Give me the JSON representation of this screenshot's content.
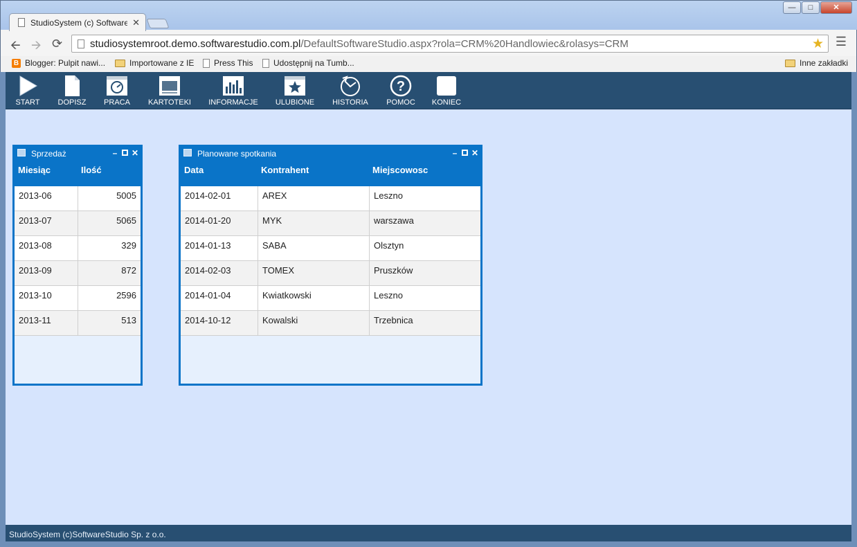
{
  "browser": {
    "tab_title": "StudioSystem (c) Software",
    "url_domain": "studiosystemroot.demo.softwarestudio.com.pl",
    "url_path": "/DefaultSoftwareStudio.aspx?rola=CRM%20Handlowiec&rolasys=CRM",
    "bookmarks": [
      {
        "label": "Blogger: Pulpit nawi...",
        "icon": "blogger-icon"
      },
      {
        "label": "Importowane z IE",
        "icon": "folder-icon"
      },
      {
        "label": "Press This",
        "icon": "page-icon"
      },
      {
        "label": "Udostępnij na Tumb...",
        "icon": "page-icon"
      }
    ],
    "other_bookmarks": "Inne zakładki"
  },
  "menu": [
    {
      "label": "START",
      "icon": "play-icon"
    },
    {
      "label": "DOPISZ",
      "icon": "new-document-icon"
    },
    {
      "label": "PRACA",
      "icon": "work-dashboard-icon"
    },
    {
      "label": "KARTOTEKI",
      "icon": "monitor-icon"
    },
    {
      "label": "INFORMACJE",
      "icon": "bar-chart-icon"
    },
    {
      "label": "ULUBIONE",
      "icon": "star-icon"
    },
    {
      "label": "HISTORIA",
      "icon": "history-icon"
    },
    {
      "label": "POMOC",
      "icon": "help-icon"
    },
    {
      "label": "KONIEC",
      "icon": "exit-icon"
    }
  ],
  "sales_panel": {
    "title": "Sprzedaż",
    "columns": [
      "Miesiąc",
      "Ilość"
    ],
    "rows": [
      [
        "2013-06",
        "5005"
      ],
      [
        "2013-07",
        "5065"
      ],
      [
        "2013-08",
        "329"
      ],
      [
        "2013-09",
        "872"
      ],
      [
        "2013-10",
        "2596"
      ],
      [
        "2013-11",
        "513"
      ]
    ]
  },
  "meetings_panel": {
    "title": "Planowane spotkania",
    "columns": [
      "Data",
      "Kontrahent",
      "Miejscowosc"
    ],
    "rows": [
      [
        "2014-02-01",
        "AREX",
        "Leszno"
      ],
      [
        "2014-01-20",
        "MYK",
        "warszawa"
      ],
      [
        "2014-01-13",
        "SABA",
        "Olsztyn"
      ],
      [
        "2014-02-03",
        "TOMEX",
        "Pruszków"
      ],
      [
        "2014-01-04",
        "Kwiatkowski",
        "Leszno"
      ],
      [
        "2014-10-12",
        "Kowalski",
        "Trzebnica"
      ]
    ]
  },
  "footer": "StudioSystem (c)SoftwareStudio Sp. z o.o.",
  "colors": {
    "menu_bar": "#284f72",
    "panel_accent": "#0a74c8",
    "app_background": "#d6e4fd"
  }
}
